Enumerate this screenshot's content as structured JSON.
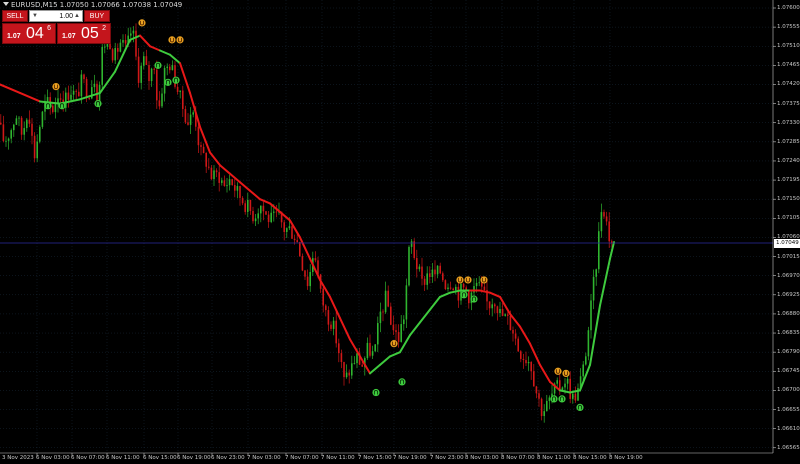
{
  "header": {
    "ticker_text": "EURUSD,M15  1.07050 1.07066 1.07038 1.07049"
  },
  "trade_panel": {
    "sell_label": "SELL",
    "buy_label": "BUY",
    "lot_value": "1.00",
    "sell_quote": {
      "small": "1.07",
      "big": "04",
      "sup": "6"
    },
    "buy_quote": {
      "small": "1.07",
      "big": "05",
      "sup": "2"
    }
  },
  "price_axis": {
    "labels": [
      "1.07600",
      "1.07555",
      "1.07510",
      "1.07465",
      "1.07420",
      "1.07375",
      "1.07330",
      "1.07285",
      "1.07240",
      "1.07195",
      "1.07150",
      "1.07105",
      "1.07060",
      "1.07015",
      "1.06970",
      "1.06925",
      "1.06880",
      "1.06835",
      "1.06790",
      "1.06745",
      "1.06700",
      "1.06655",
      "1.06610",
      "1.06565"
    ],
    "current_price": "1.07049"
  },
  "time_axis": {
    "labels": [
      "3 Nov 2023",
      "6 Nov 03:00",
      "6 Nov 07:00",
      "6 Nov 11:00",
      "6 Nov 15:00",
      "6 Nov 19:00",
      "6 Nov 23:00",
      "7 Nov 03:00",
      "7 Nov 07:00",
      "7 Nov 11:00",
      "7 Nov 15:00",
      "7 Nov 19:00",
      "7 Nov 23:00",
      "8 Nov 03:00",
      "8 Nov 07:00",
      "8 Nov 11:00",
      "8 Nov 15:00",
      "8 Nov 19:00"
    ]
  },
  "colors": {
    "background": "#000000",
    "grid": "#1a2a3a",
    "bull": "#2fb52f",
    "bear": "#d01818",
    "ma_up": "#3ecb3e",
    "ma_down": "#e81818",
    "signal_up": "#3ecb3e",
    "signal_down": "#e8a020"
  },
  "chart_data": {
    "type": "candlestick",
    "symbol": "EURUSD",
    "timeframe": "M15",
    "ylim": [
      1.06565,
      1.076
    ],
    "time_labels": [
      "3 Nov 2023",
      "6 Nov 03:00",
      "6 Nov 07:00",
      "6 Nov 11:00",
      "6 Nov 15:00",
      "6 Nov 19:00",
      "6 Nov 23:00",
      "7 Nov 03:00",
      "7 Nov 07:00",
      "7 Nov 11:00",
      "7 Nov 15:00",
      "7 Nov 19:00",
      "7 Nov 23:00",
      "8 Nov 03:00",
      "8 Nov 07:00",
      "8 Nov 11:00",
      "8 Nov 15:00",
      "8 Nov 19:00"
    ],
    "price_path": [
      [
        0,
        1.0733
      ],
      [
        6,
        1.07285
      ],
      [
        12,
        1.0731
      ],
      [
        18,
        1.0735
      ],
      [
        24,
        1.073
      ],
      [
        30,
        1.0737
      ],
      [
        36,
        1.0725
      ],
      [
        42,
        1.0733
      ],
      [
        48,
        1.0738
      ],
      [
        54,
        1.0736
      ],
      [
        60,
        1.074
      ],
      [
        66,
        1.0738
      ],
      [
        72,
        1.0741
      ],
      [
        78,
        1.0739
      ],
      [
        84,
        1.0743
      ],
      [
        90,
        1.074
      ],
      [
        96,
        1.0744
      ],
      [
        100,
        1.0738
      ],
      [
        104,
        1.075
      ],
      [
        110,
        1.0754
      ],
      [
        116,
        1.0748
      ],
      [
        122,
        1.0752
      ],
      [
        128,
        1.075
      ],
      [
        134,
        1.07555
      ],
      [
        140,
        1.0744
      ],
      [
        146,
        1.0748
      ],
      [
        150,
        1.0743
      ],
      [
        156,
        1.0747
      ],
      [
        160,
        1.0735
      ],
      [
        166,
        1.0745
      ],
      [
        172,
        1.0747
      ],
      [
        178,
        1.0742
      ],
      [
        184,
        1.0737
      ],
      [
        190,
        1.0733
      ],
      [
        196,
        1.0736
      ],
      [
        202,
        1.0726
      ],
      [
        208,
        1.0724
      ],
      [
        214,
        1.072
      ],
      [
        220,
        1.0721
      ],
      [
        226,
        1.0718
      ],
      [
        232,
        1.072
      ],
      [
        238,
        1.0717
      ],
      [
        244,
        1.0715
      ],
      [
        250,
        1.0713
      ],
      [
        256,
        1.0711
      ],
      [
        262,
        1.0714
      ],
      [
        268,
        1.0711
      ],
      [
        274,
        1.071
      ],
      [
        280,
        1.0711
      ],
      [
        286,
        1.0708
      ],
      [
        292,
        1.0708
      ],
      [
        298,
        1.0706
      ],
      [
        304,
        1.07
      ],
      [
        310,
        1.0695
      ],
      [
        316,
        1.0704
      ],
      [
        322,
        1.0693
      ],
      [
        328,
        1.0688
      ],
      [
        334,
        1.0686
      ],
      [
        340,
        1.068
      ],
      [
        346,
        1.0672
      ],
      [
        352,
        1.0675
      ],
      [
        358,
        1.0678
      ],
      [
        364,
        1.0676
      ],
      [
        370,
        1.068
      ],
      [
        376,
        1.0678
      ],
      [
        382,
        1.0688
      ],
      [
        388,
        1.0692
      ],
      [
        394,
        1.0685
      ],
      [
        400,
        1.0682
      ],
      [
        406,
        1.0688
      ],
      [
        412,
        1.0706
      ],
      [
        418,
        1.07
      ],
      [
        424,
        1.0695
      ],
      [
        430,
        1.0698
      ],
      [
        436,
        1.0697
      ],
      [
        442,
        1.0698
      ],
      [
        448,
        1.0695
      ],
      [
        454,
        1.0696
      ],
      [
        460,
        1.0693
      ],
      [
        466,
        1.0694
      ],
      [
        472,
        1.0692
      ],
      [
        478,
        1.0695
      ],
      [
        484,
        1.0693
      ],
      [
        490,
        1.069
      ],
      [
        496,
        1.0692
      ],
      [
        502,
        1.0688
      ],
      [
        508,
        1.0687
      ],
      [
        514,
        1.0685
      ],
      [
        520,
        1.068
      ],
      [
        526,
        1.0678
      ],
      [
        532,
        1.0677
      ],
      [
        538,
        1.067
      ],
      [
        544,
        1.0665
      ],
      [
        550,
        1.0667
      ],
      [
        556,
        1.067
      ],
      [
        562,
        1.0671
      ],
      [
        568,
        1.0673
      ],
      [
        574,
        1.0668
      ],
      [
        580,
        1.067
      ],
      [
        586,
        1.0676
      ],
      [
        592,
        1.0688
      ],
      [
        598,
        1.07
      ],
      [
        604,
        1.0715
      ],
      [
        608,
        1.071
      ],
      [
        612,
        1.07049
      ]
    ],
    "ma_path": [
      [
        0,
        1.0742
      ],
      [
        20,
        1.074
      ],
      [
        40,
        1.0738
      ],
      [
        60,
        1.07375
      ],
      [
        80,
        1.07385
      ],
      [
        100,
        1.074
      ],
      [
        115,
        1.0745
      ],
      [
        130,
        1.07525
      ],
      [
        140,
        1.07535
      ],
      [
        150,
        1.0751
      ],
      [
        160,
        1.075
      ],
      [
        170,
        1.0749
      ],
      [
        180,
        1.0747
      ],
      [
        190,
        1.074
      ],
      [
        200,
        1.0732
      ],
      [
        210,
        1.0726
      ],
      [
        220,
        1.0723
      ],
      [
        230,
        1.0721
      ],
      [
        240,
        1.0719
      ],
      [
        250,
        1.0717
      ],
      [
        260,
        1.0715
      ],
      [
        270,
        1.0714
      ],
      [
        280,
        1.0712
      ],
      [
        290,
        1.071
      ],
      [
        300,
        1.0706
      ],
      [
        310,
        1.0701
      ],
      [
        320,
        1.0696
      ],
      [
        330,
        1.0692
      ],
      [
        340,
        1.0687
      ],
      [
        350,
        1.0682
      ],
      [
        360,
        1.0678
      ],
      [
        370,
        1.0674
      ],
      [
        380,
        1.0676
      ],
      [
        390,
        1.0678
      ],
      [
        400,
        1.0679
      ],
      [
        410,
        1.0683
      ],
      [
        420,
        1.0686
      ],
      [
        430,
        1.0689
      ],
      [
        440,
        1.0692
      ],
      [
        450,
        1.0693
      ],
      [
        460,
        1.06935
      ],
      [
        470,
        1.06935
      ],
      [
        480,
        1.06935
      ],
      [
        490,
        1.0693
      ],
      [
        500,
        1.0692
      ],
      [
        510,
        1.0688
      ],
      [
        520,
        1.0685
      ],
      [
        530,
        1.0681
      ],
      [
        540,
        1.0676
      ],
      [
        550,
        1.0672
      ],
      [
        560,
        1.067
      ],
      [
        570,
        1.06695
      ],
      [
        580,
        1.067
      ],
      [
        590,
        1.0676
      ],
      [
        600,
        1.069
      ],
      [
        610,
        1.0701
      ],
      [
        614,
        1.07049
      ]
    ],
    "ma_green_ranges": [
      [
        40,
        140
      ],
      [
        165,
        180
      ],
      [
        370,
        470
      ],
      [
        562,
        614
      ]
    ],
    "signals_up": [
      [
        48,
        1.0737
      ],
      [
        62,
        1.0737
      ],
      [
        98,
        1.07375
      ],
      [
        158,
        1.07465
      ],
      [
        168,
        1.07425
      ],
      [
        176,
        1.0743
      ],
      [
        376,
        1.06695
      ],
      [
        402,
        1.0672
      ],
      [
        464,
        1.06925
      ],
      [
        474,
        1.06915
      ],
      [
        554,
        1.0668
      ],
      [
        562,
        1.0668
      ],
      [
        580,
        1.0666
      ]
    ],
    "signals_down": [
      [
        56,
        1.07415
      ],
      [
        142,
        1.07565
      ],
      [
        172,
        1.07525
      ],
      [
        180,
        1.07525
      ],
      [
        394,
        1.0681
      ],
      [
        460,
        1.0696
      ],
      [
        468,
        1.0696
      ],
      [
        484,
        1.0696
      ],
      [
        558,
        1.06745
      ],
      [
        566,
        1.0674
      ]
    ]
  }
}
